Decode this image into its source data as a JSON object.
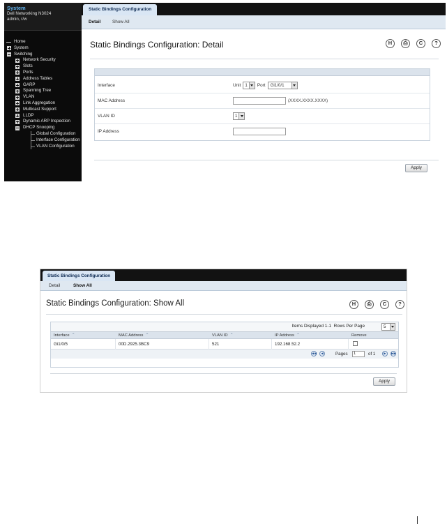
{
  "detail_view": {
    "sidebar": {
      "system_title": "System",
      "device_name": "Dell Networking N3024",
      "user": "admin, r/w",
      "tree": [
        {
          "label": "Home",
          "type": "leaf"
        },
        {
          "label": "System",
          "type": "plus"
        },
        {
          "label": "Switching",
          "type": "minus"
        },
        {
          "label": "Network Security",
          "type": "plus"
        },
        {
          "label": "Slots",
          "type": "plus"
        },
        {
          "label": "Ports",
          "type": "plus"
        },
        {
          "label": "Address Tables",
          "type": "plus"
        },
        {
          "label": "GARP",
          "type": "plus"
        },
        {
          "label": "Spanning Tree",
          "type": "plus"
        },
        {
          "label": "VLAN",
          "type": "plus"
        },
        {
          "label": "Link Aggregation",
          "type": "plus"
        },
        {
          "label": "Multicast Support",
          "type": "plus"
        },
        {
          "label": "LLDP",
          "type": "plus"
        },
        {
          "label": "Dynamic ARP Inspection",
          "type": "plus"
        },
        {
          "label": "DHCP Snooping",
          "type": "minus"
        },
        {
          "label": "Global Configuration",
          "type": "child"
        },
        {
          "label": "Interface Configuration",
          "type": "child"
        },
        {
          "label": "VLAN Configuration",
          "type": "child"
        }
      ]
    },
    "tab_title": "Static Bindings Configuration",
    "subtabs": [
      "Detail",
      "Show All"
    ],
    "heading": "Static Bindings Configuration: Detail",
    "toolbar_icons": [
      "help-icon",
      "print-icon",
      "refresh-icon",
      "question-icon"
    ],
    "toolbar_glyphs": [
      "H",
      "⎙",
      "C",
      "?"
    ],
    "fields": {
      "interface_label": "Interface",
      "unit_label": "Unit",
      "unit_value": "1",
      "port_label": "Port",
      "port_value": "Gi1/0/1",
      "mac_label": "MAC Address",
      "mac_hint": "(XXXX.XXXX.XXXX)",
      "vlan_label": "VLAN ID",
      "vlan_value": "1",
      "ip_label": "IP Address"
    },
    "apply_label": "Apply"
  },
  "show_all_view": {
    "tab_title": "Static Bindings Configuration",
    "subtabs": [
      "Detail",
      "Show All"
    ],
    "heading": "Static Bindings Configuration: Show All",
    "toolbar_glyphs": [
      "H",
      "⎙",
      "C",
      "?"
    ],
    "items_displayed": "Items Displayed 1-1",
    "rows_per_page_label": "Rows Per Page",
    "rows_per_page_value": "5",
    "columns": [
      "Interface",
      "MAC Address",
      "VLAN ID",
      "IP Address",
      "Remove"
    ],
    "rows": [
      {
        "interface": "Gi1/0/5",
        "mac": "00D.2925.3BC9",
        "vlan": "521",
        "ip": "192.168.52.2",
        "remove": false
      }
    ],
    "pages_label": "Pages",
    "page_value": "1",
    "of_label": "of 1",
    "apply_label": "Apply"
  }
}
